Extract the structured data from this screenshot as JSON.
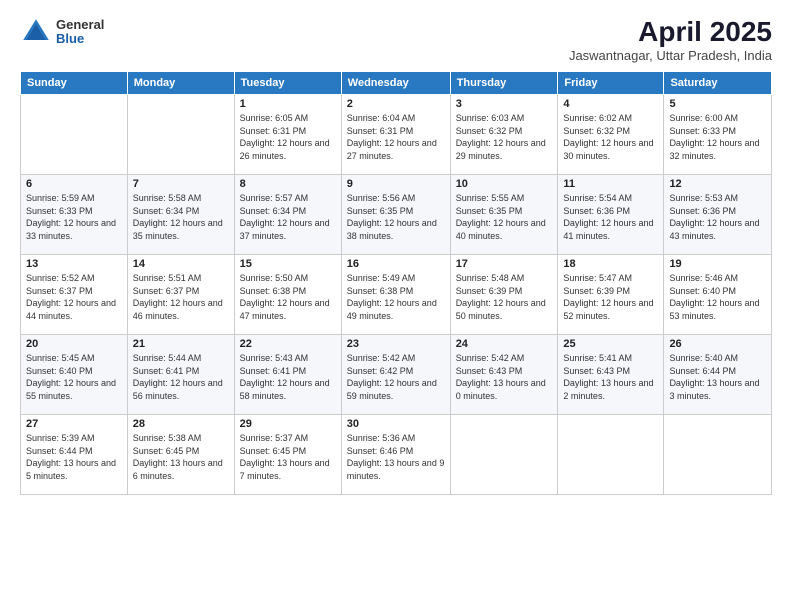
{
  "logo": {
    "general": "General",
    "blue": "Blue"
  },
  "header": {
    "month": "April 2025",
    "location": "Jaswantnagar, Uttar Pradesh, India"
  },
  "weekdays": [
    "Sunday",
    "Monday",
    "Tuesday",
    "Wednesday",
    "Thursday",
    "Friday",
    "Saturday"
  ],
  "weeks": [
    [
      {
        "day": "",
        "info": ""
      },
      {
        "day": "",
        "info": ""
      },
      {
        "day": "1",
        "info": "Sunrise: 6:05 AM\nSunset: 6:31 PM\nDaylight: 12 hours and 26 minutes."
      },
      {
        "day": "2",
        "info": "Sunrise: 6:04 AM\nSunset: 6:31 PM\nDaylight: 12 hours and 27 minutes."
      },
      {
        "day": "3",
        "info": "Sunrise: 6:03 AM\nSunset: 6:32 PM\nDaylight: 12 hours and 29 minutes."
      },
      {
        "day": "4",
        "info": "Sunrise: 6:02 AM\nSunset: 6:32 PM\nDaylight: 12 hours and 30 minutes."
      },
      {
        "day": "5",
        "info": "Sunrise: 6:00 AM\nSunset: 6:33 PM\nDaylight: 12 hours and 32 minutes."
      }
    ],
    [
      {
        "day": "6",
        "info": "Sunrise: 5:59 AM\nSunset: 6:33 PM\nDaylight: 12 hours and 33 minutes."
      },
      {
        "day": "7",
        "info": "Sunrise: 5:58 AM\nSunset: 6:34 PM\nDaylight: 12 hours and 35 minutes."
      },
      {
        "day": "8",
        "info": "Sunrise: 5:57 AM\nSunset: 6:34 PM\nDaylight: 12 hours and 37 minutes."
      },
      {
        "day": "9",
        "info": "Sunrise: 5:56 AM\nSunset: 6:35 PM\nDaylight: 12 hours and 38 minutes."
      },
      {
        "day": "10",
        "info": "Sunrise: 5:55 AM\nSunset: 6:35 PM\nDaylight: 12 hours and 40 minutes."
      },
      {
        "day": "11",
        "info": "Sunrise: 5:54 AM\nSunset: 6:36 PM\nDaylight: 12 hours and 41 minutes."
      },
      {
        "day": "12",
        "info": "Sunrise: 5:53 AM\nSunset: 6:36 PM\nDaylight: 12 hours and 43 minutes."
      }
    ],
    [
      {
        "day": "13",
        "info": "Sunrise: 5:52 AM\nSunset: 6:37 PM\nDaylight: 12 hours and 44 minutes."
      },
      {
        "day": "14",
        "info": "Sunrise: 5:51 AM\nSunset: 6:37 PM\nDaylight: 12 hours and 46 minutes."
      },
      {
        "day": "15",
        "info": "Sunrise: 5:50 AM\nSunset: 6:38 PM\nDaylight: 12 hours and 47 minutes."
      },
      {
        "day": "16",
        "info": "Sunrise: 5:49 AM\nSunset: 6:38 PM\nDaylight: 12 hours and 49 minutes."
      },
      {
        "day": "17",
        "info": "Sunrise: 5:48 AM\nSunset: 6:39 PM\nDaylight: 12 hours and 50 minutes."
      },
      {
        "day": "18",
        "info": "Sunrise: 5:47 AM\nSunset: 6:39 PM\nDaylight: 12 hours and 52 minutes."
      },
      {
        "day": "19",
        "info": "Sunrise: 5:46 AM\nSunset: 6:40 PM\nDaylight: 12 hours and 53 minutes."
      }
    ],
    [
      {
        "day": "20",
        "info": "Sunrise: 5:45 AM\nSunset: 6:40 PM\nDaylight: 12 hours and 55 minutes."
      },
      {
        "day": "21",
        "info": "Sunrise: 5:44 AM\nSunset: 6:41 PM\nDaylight: 12 hours and 56 minutes."
      },
      {
        "day": "22",
        "info": "Sunrise: 5:43 AM\nSunset: 6:41 PM\nDaylight: 12 hours and 58 minutes."
      },
      {
        "day": "23",
        "info": "Sunrise: 5:42 AM\nSunset: 6:42 PM\nDaylight: 12 hours and 59 minutes."
      },
      {
        "day": "24",
        "info": "Sunrise: 5:42 AM\nSunset: 6:43 PM\nDaylight: 13 hours and 0 minutes."
      },
      {
        "day": "25",
        "info": "Sunrise: 5:41 AM\nSunset: 6:43 PM\nDaylight: 13 hours and 2 minutes."
      },
      {
        "day": "26",
        "info": "Sunrise: 5:40 AM\nSunset: 6:44 PM\nDaylight: 13 hours and 3 minutes."
      }
    ],
    [
      {
        "day": "27",
        "info": "Sunrise: 5:39 AM\nSunset: 6:44 PM\nDaylight: 13 hours and 5 minutes."
      },
      {
        "day": "28",
        "info": "Sunrise: 5:38 AM\nSunset: 6:45 PM\nDaylight: 13 hours and 6 minutes."
      },
      {
        "day": "29",
        "info": "Sunrise: 5:37 AM\nSunset: 6:45 PM\nDaylight: 13 hours and 7 minutes."
      },
      {
        "day": "30",
        "info": "Sunrise: 5:36 AM\nSunset: 6:46 PM\nDaylight: 13 hours and 9 minutes."
      },
      {
        "day": "",
        "info": ""
      },
      {
        "day": "",
        "info": ""
      },
      {
        "day": "",
        "info": ""
      }
    ]
  ]
}
